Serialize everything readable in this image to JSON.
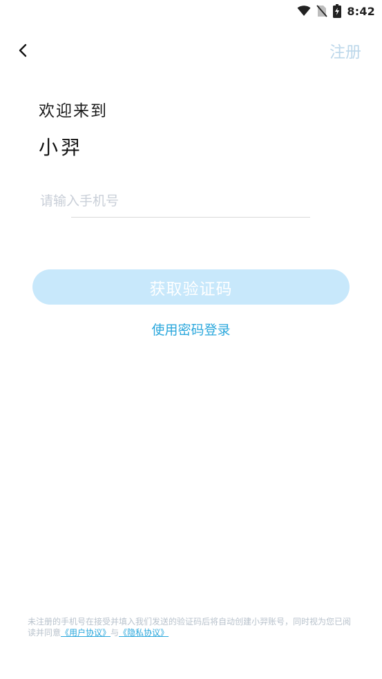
{
  "status_bar": {
    "time": "8:42",
    "icons": [
      "wifi-icon",
      "no-sim-icon",
      "battery-charging-icon"
    ]
  },
  "nav": {
    "back_icon": "chevron-left-icon",
    "register_label": "注册"
  },
  "welcome": {
    "line1": "欢迎来到",
    "app_name": "小羿"
  },
  "phone": {
    "placeholder": "请输入手机号",
    "value": ""
  },
  "actions": {
    "get_code_label": "获取验证码",
    "password_login_label": "使用密码登录"
  },
  "agreement": {
    "text": "未注册的手机号在接受并填入我们发送的验证码后将自动创建小羿账号，同时视为您已阅读并同意",
    "user_agreement": "《用户协议》",
    "joiner": "与",
    "privacy_policy": "《隐私协议》"
  },
  "colors": {
    "accent": "#2aa7dc",
    "button_disabled_bg": "#c8e8fb",
    "register_text": "#bcd7ea",
    "placeholder": "#c9cfd8"
  }
}
